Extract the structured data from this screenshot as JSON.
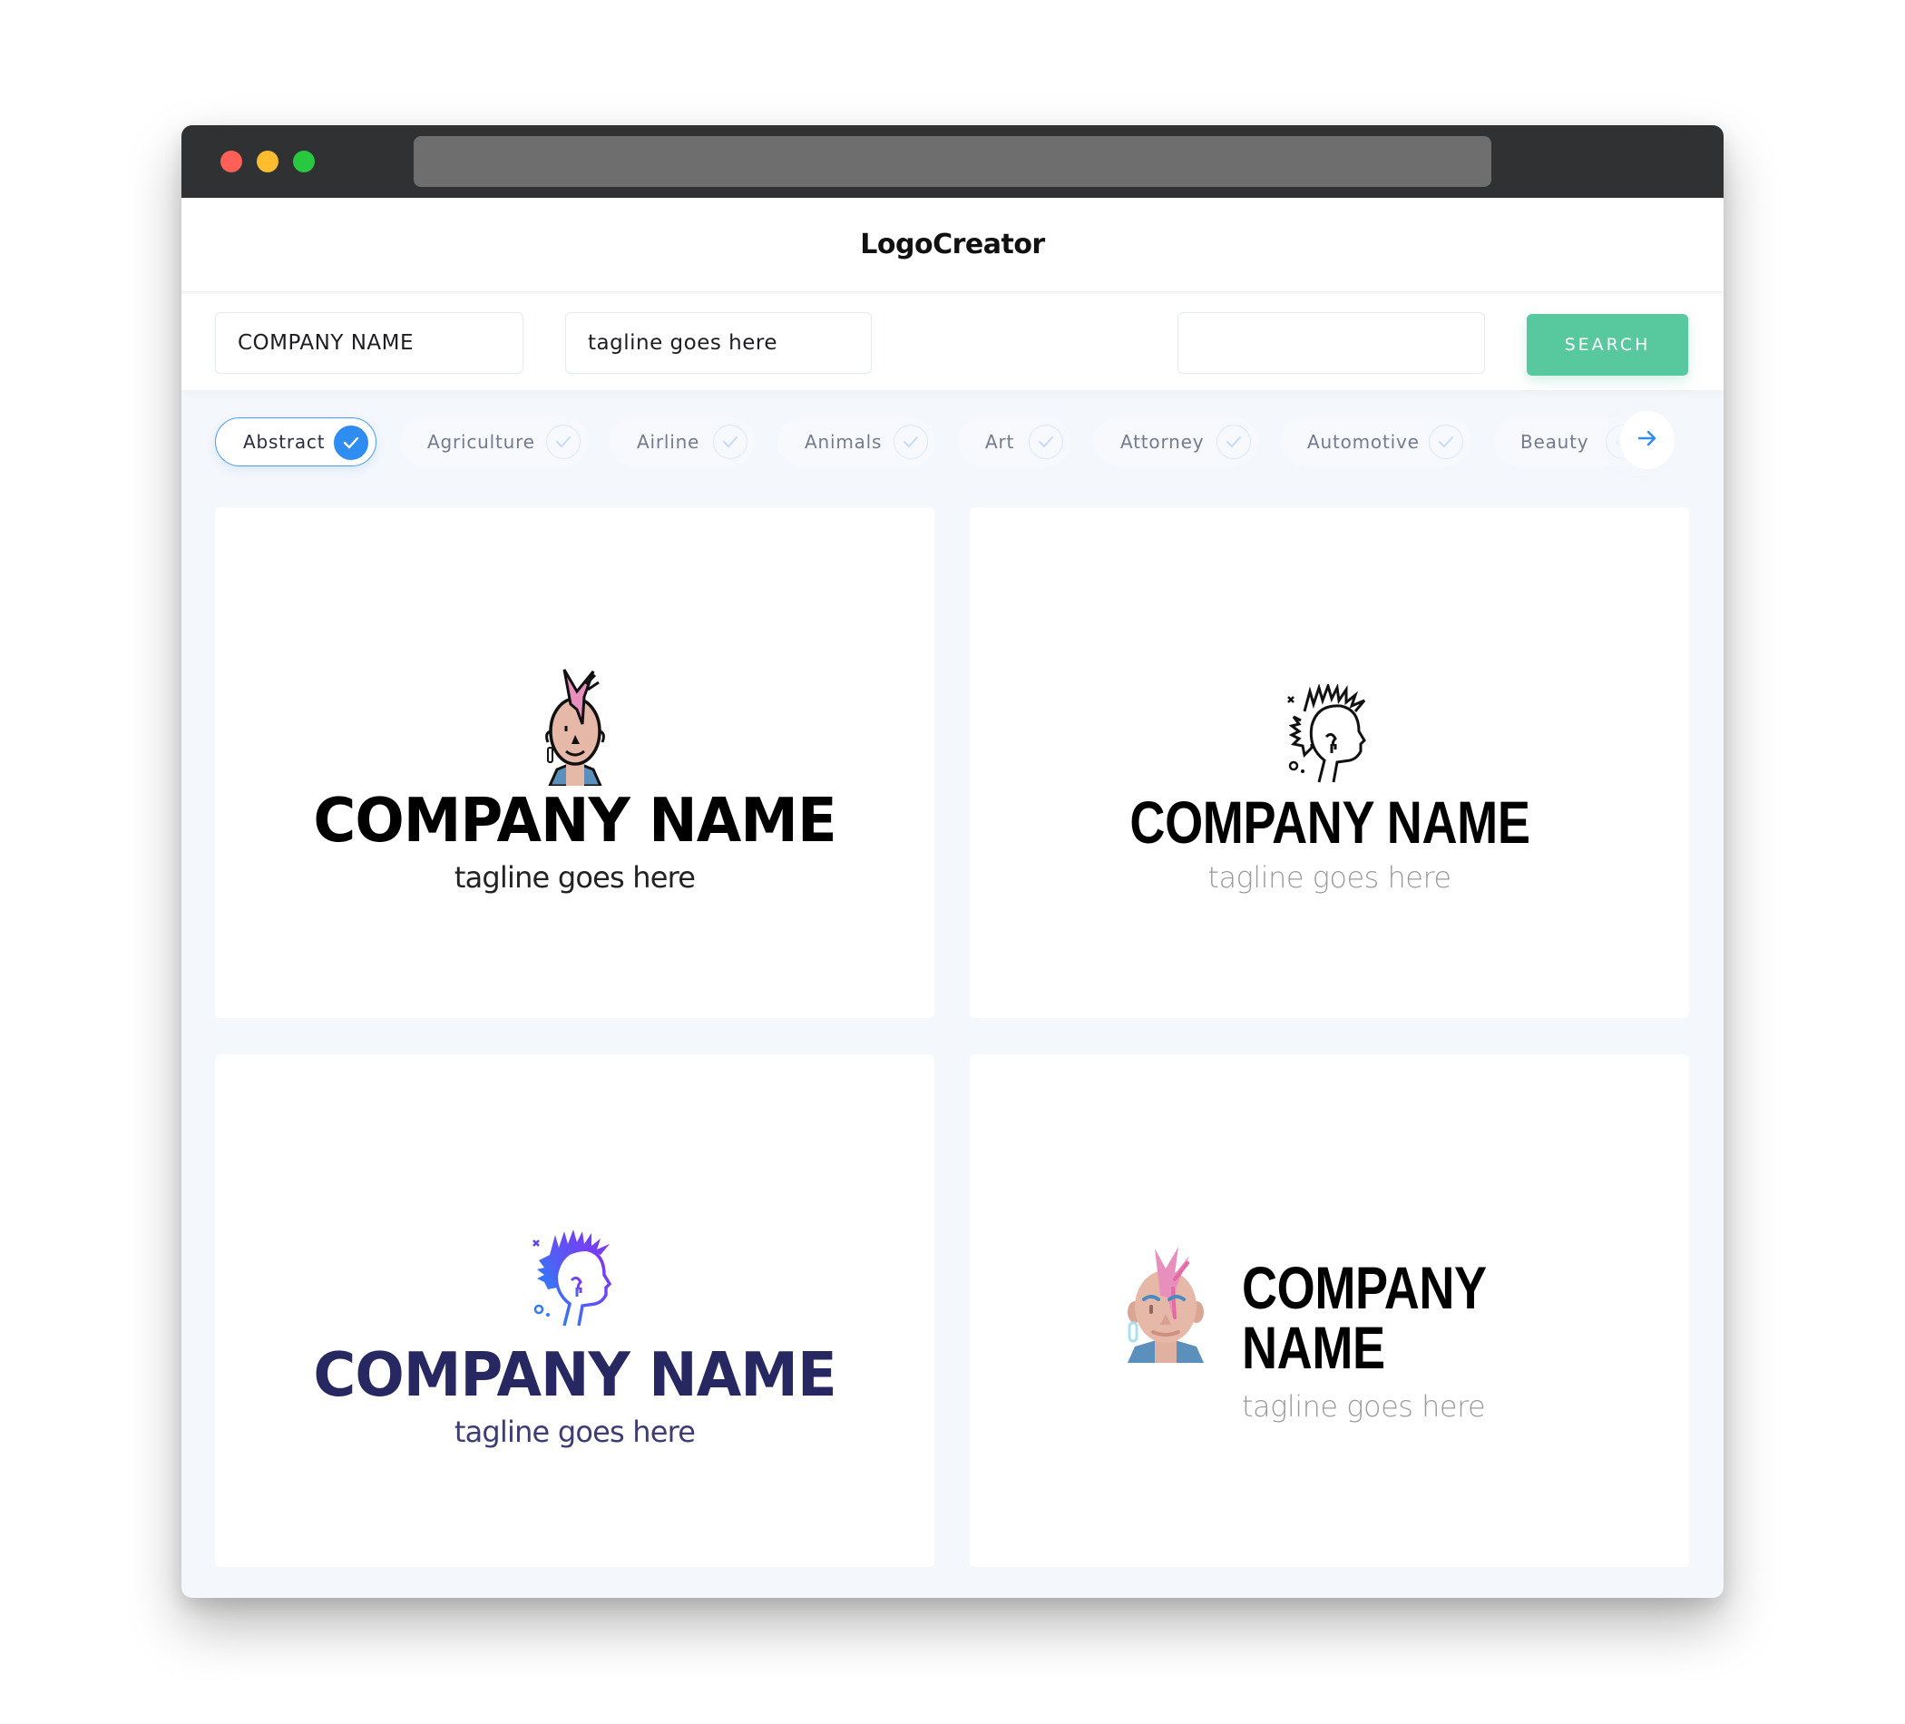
{
  "window": {
    "traffic_lights": [
      "close",
      "minimize",
      "maximize"
    ],
    "url": ""
  },
  "header": {
    "title": "LogoCreator"
  },
  "search": {
    "company_name_value": "COMPANY NAME",
    "tagline_value": "tagline goes here",
    "keyword_value": "",
    "button_label": "SEARCH"
  },
  "categories": {
    "items": [
      {
        "label": "Abstract",
        "selected": true
      },
      {
        "label": "Agriculture",
        "selected": false
      },
      {
        "label": "Airline",
        "selected": false
      },
      {
        "label": "Animals",
        "selected": false
      },
      {
        "label": "Art",
        "selected": false
      },
      {
        "label": "Attorney",
        "selected": false
      },
      {
        "label": "Automotive",
        "selected": false
      },
      {
        "label": "Beauty",
        "selected": false
      }
    ],
    "next_icon": "arrow-right-icon"
  },
  "colors": {
    "accent_blue": "#2f8cf0",
    "search_green": "#58c89f",
    "navy_text": "#272862",
    "mohawk_pink": "#e98fbd",
    "jacket_blue": "#5b8fbc",
    "skin": "#e6b8a8"
  },
  "logos": [
    {
      "icon": "punk-face-filled-outline-icon",
      "company": "COMPANY NAME",
      "tagline": "tagline goes here",
      "layout": "stacked"
    },
    {
      "icon": "punk-profile-line-icon",
      "company": "COMPANY NAME",
      "tagline": "tagline goes here",
      "layout": "stacked"
    },
    {
      "icon": "punk-profile-gradient-icon",
      "company": "COMPANY NAME",
      "tagline": "tagline goes here",
      "layout": "stacked"
    },
    {
      "icon": "punk-face-flat-icon",
      "company": "COMPANY NAME",
      "tagline": "tagline goes here",
      "layout": "inline"
    }
  ]
}
